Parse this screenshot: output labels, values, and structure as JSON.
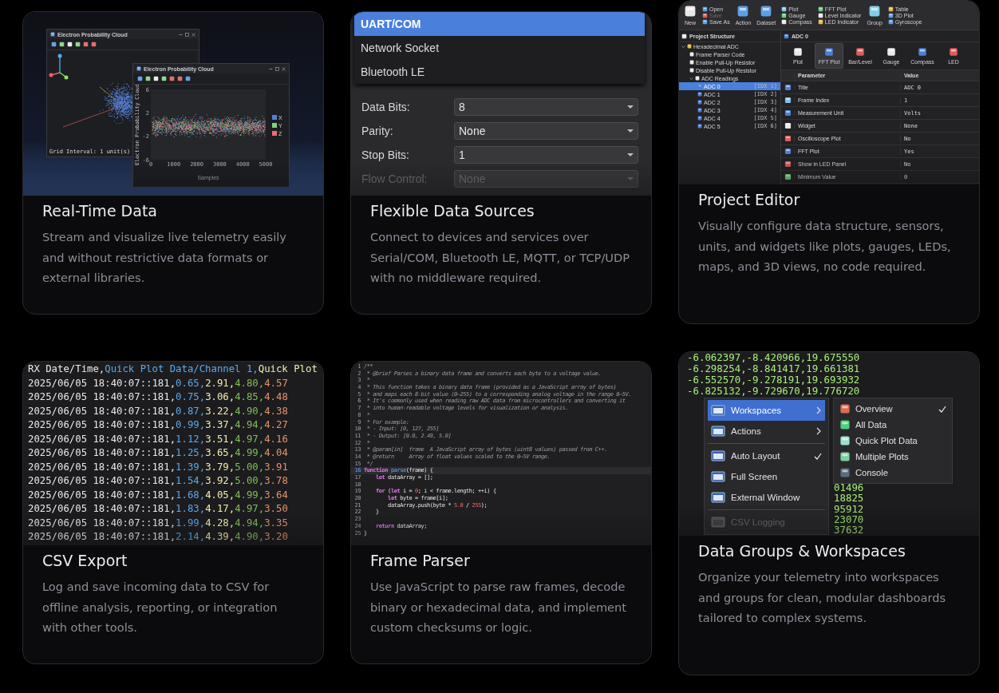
{
  "cards": [
    {
      "kind": "plots",
      "title": "Real-Time Data",
      "description": "Stream and visualize live telemetry easily and without restrictive data formats or external libraries.",
      "windows": [
        {
          "kind": "scene",
          "title": "Electron Probability Cloud",
          "caption": "Grid Interval: 1 unit(s)"
        },
        {
          "kind": "plot",
          "title": "Electron Probability Cloud",
          "xlabel": "Samples",
          "ylabel": "Electron Probability Cloud",
          "yticks": [
            "6",
            "2",
            "-2",
            "-6"
          ],
          "xticks": [
            "0",
            "1000",
            "2000",
            "3000",
            "4000",
            "5000"
          ],
          "legend": [
            {
              "label": "X",
              "color": "#4f7fe0"
            },
            {
              "label": "Y",
              "color": "#7fd67a"
            },
            {
              "label": "Z",
              "color": "#f06a78"
            }
          ]
        }
      ]
    },
    {
      "kind": "sources",
      "title": "Flexible Data Sources",
      "description": "Connect to devices and services over Serial/COM, Bluetooth LE, MQTT, or TCP/UDP with no middleware required.",
      "options": [
        {
          "label": "UART/COM",
          "selected": true
        },
        {
          "label": "Network Socket",
          "selected": false
        },
        {
          "label": "Bluetooth LE",
          "selected": false
        }
      ],
      "fields": [
        {
          "label": "Data Bits:",
          "value": "8",
          "disabled": false
        },
        {
          "label": "Parity:",
          "value": "None",
          "disabled": false
        },
        {
          "label": "Stop Bits:",
          "value": "1",
          "disabled": false
        },
        {
          "label": "Flow Control:",
          "value": "None",
          "disabled": true
        }
      ]
    },
    {
      "kind": "editor",
      "title": "Project Editor",
      "description": "Visually configure data structure, sensors, units, and widgets like plots, gauges, LEDs, maps, and 3D views, no code required.",
      "toolbar": [
        {
          "kind": "large",
          "label": "New"
        },
        {
          "kind": "stack",
          "items": [
            {
              "label": "Open",
              "disabled": false
            },
            {
              "label": "Save",
              "disabled": true
            },
            {
              "label": "Save As",
              "disabled": false
            }
          ]
        },
        {
          "kind": "large",
          "label": "Action"
        },
        {
          "kind": "large",
          "label": "Dataset"
        },
        {
          "kind": "stack",
          "items": [
            {
              "label": "Plot",
              "disabled": false
            },
            {
              "label": "Gauge",
              "disabled": false
            },
            {
              "label": "Compass",
              "disabled": false
            }
          ]
        },
        {
          "kind": "stack",
          "items": [
            {
              "label": "FFT Plot",
              "disabled": false
            },
            {
              "label": "Level Indicator",
              "disabled": false
            },
            {
              "label": "LED Indicator",
              "disabled": false
            }
          ]
        },
        {
          "kind": "large",
          "label": "Group"
        },
        {
          "kind": "stack",
          "items": [
            {
              "label": "Table",
              "disabled": false
            },
            {
              "label": "3D Plot",
              "disabled": false
            },
            {
              "label": "Gyroscope",
              "disabled": false
            }
          ]
        }
      ],
      "sidebar": {
        "title": "Project Structure",
        "tree": [
          {
            "label": "Hexadecimal ADC",
            "selected": false,
            "expanded": true,
            "children": [
              {
                "label": "Frame Parser Code",
                "selected": false
              },
              {
                "label": "Enable Pull-Up Resistor",
                "selected": false
              },
              {
                "label": "Disable Pull-Up Resistor",
                "selected": false
              },
              {
                "label": "ADC Readings",
                "selected": false,
                "expanded": true,
                "children": [
                  {
                    "label": "ADC 0",
                    "index": "[IDX 1]",
                    "selected": true
                  },
                  {
                    "label": "ADC 1",
                    "index": "[IDX 2]",
                    "selected": false
                  },
                  {
                    "label": "ADC 2",
                    "index": "[IDX 3]",
                    "selected": false
                  },
                  {
                    "label": "ADC 3",
                    "index": "[IDX 4]",
                    "selected": false
                  },
                  {
                    "label": "ADC 4",
                    "index": "[IDX 5]",
                    "selected": false
                  },
                  {
                    "label": "ADC 5",
                    "index": "[IDX 6]",
                    "selected": false
                  }
                ]
              }
            ]
          }
        ]
      },
      "panel": {
        "title": "ADC 0",
        "widgets": [
          {
            "label": "Plot",
            "selected": false
          },
          {
            "label": "FFT Plot",
            "selected": true
          },
          {
            "label": "Bar/Level",
            "selected": false
          },
          {
            "label": "Gauge",
            "selected": false
          },
          {
            "label": "Compass",
            "selected": false
          },
          {
            "label": "LED",
            "selected": false
          }
        ],
        "columns": [
          "Parameter",
          "Value"
        ],
        "rows": [
          {
            "parameter": "Title",
            "value": "ADC 0"
          },
          {
            "parameter": "Frame Index",
            "value": "1"
          },
          {
            "parameter": "Measurement Unit",
            "value": "Volts"
          },
          {
            "parameter": "Widget",
            "value": "None"
          },
          {
            "parameter": "Oscilloscope Plot",
            "value": "No"
          },
          {
            "parameter": "FFT Plot",
            "value": "Yes"
          },
          {
            "parameter": "Show in LED Panel",
            "value": "No"
          },
          {
            "parameter": "Minimum Value",
            "value": "0"
          }
        ]
      }
    },
    {
      "kind": "csv",
      "title": "CSV Export",
      "description": "Log and save incoming data to CSV for offline analysis, reporting, or integration with other tools.",
      "header": [
        "RX Date/Time,",
        "Quick Plot Data/Channel 1,",
        "Quick Plot"
      ],
      "rows": [
        {
          "time": "2025/06/05 18:40:07::181,",
          "values": [
            "0.65,",
            "2.91,",
            "4.80,",
            "4.57"
          ]
        },
        {
          "time": "2025/06/05 18:40:07::181,",
          "values": [
            "0.75,",
            "3.06,",
            "4.85,",
            "4.48"
          ]
        },
        {
          "time": "2025/06/05 18:40:07::181,",
          "values": [
            "0.87,",
            "3.22,",
            "4.90,",
            "4.38"
          ]
        },
        {
          "time": "2025/06/05 18:40:07::181,",
          "values": [
            "0.99,",
            "3.37,",
            "4.94,",
            "4.27"
          ]
        },
        {
          "time": "2025/06/05 18:40:07::181,",
          "values": [
            "1.12,",
            "3.51,",
            "4.97,",
            "4.16"
          ]
        },
        {
          "time": "2025/06/05 18:40:07::181,",
          "values": [
            "1.25,",
            "3.65,",
            "4.99,",
            "4.04"
          ]
        },
        {
          "time": "2025/06/05 18:40:07::181,",
          "values": [
            "1.39,",
            "3.79,",
            "5.00,",
            "3.91"
          ]
        },
        {
          "time": "2025/06/05 18:40:07::181,",
          "values": [
            "1.54,",
            "3.92,",
            "5.00,",
            "3.78"
          ]
        },
        {
          "time": "2025/06/05 18:40:07::181,",
          "values": [
            "1.68,",
            "4.05,",
            "4.99,",
            "3.64"
          ]
        },
        {
          "time": "2025/06/05 18:40:07::181,",
          "values": [
            "1.83,",
            "4.17,",
            "4.97,",
            "3.50"
          ]
        },
        {
          "time": "2025/06/05 18:40:07::181,",
          "values": [
            "1.99,",
            "4.28,",
            "4.94,",
            "3.35"
          ]
        },
        {
          "time": "2025/06/05 18:40:07::181,",
          "values": [
            "2.14,",
            "4.39,",
            "4.90,",
            "3.20"
          ]
        }
      ]
    },
    {
      "kind": "code",
      "title": "Frame Parser",
      "description": "Use JavaScript to parse raw frames, decode binary or hexadecimal data, and implement custom checksums or logic.",
      "lines": [
        {
          "number": "1",
          "current": false,
          "tokens": [
            {
              "kind": "comment",
              "text": "/**"
            }
          ]
        },
        {
          "number": "2",
          "current": false,
          "tokens": [
            {
              "kind": "comment",
              "text": " * @brief Parses a binary data frame and converts each byte to a voltage value."
            }
          ]
        },
        {
          "number": "3",
          "current": false,
          "tokens": [
            {
              "kind": "comment",
              "text": " *"
            }
          ]
        },
        {
          "number": "4",
          "current": false,
          "tokens": [
            {
              "kind": "comment",
              "text": " * This function takes a binary data frame (provided as a JavaScript array of bytes)"
            }
          ]
        },
        {
          "number": "5",
          "current": false,
          "tokens": [
            {
              "kind": "comment",
              "text": " * and maps each 8-bit value (0–255) to a corresponding analog voltage in the range 0–5V."
            }
          ]
        },
        {
          "number": "6",
          "current": false,
          "tokens": [
            {
              "kind": "comment",
              "text": " * It's commonly used when reading raw ADC data from microcontrollers and converting it"
            }
          ]
        },
        {
          "number": "7",
          "current": false,
          "tokens": [
            {
              "kind": "comment",
              "text": " * into human-readable voltage levels for visualization or analysis."
            }
          ]
        },
        {
          "number": "8",
          "current": false,
          "tokens": [
            {
              "kind": "comment",
              "text": " *"
            }
          ]
        },
        {
          "number": "9",
          "current": false,
          "tokens": [
            {
              "kind": "comment",
              "text": " * For example:"
            }
          ]
        },
        {
          "number": "10",
          "current": false,
          "tokens": [
            {
              "kind": "comment",
              "text": " * - Input: [0, 127, 255]"
            }
          ]
        },
        {
          "number": "11",
          "current": false,
          "tokens": [
            {
              "kind": "comment",
              "text": " * - Output: [0.0, 2.49, 5.0]"
            }
          ]
        },
        {
          "number": "12",
          "current": false,
          "tokens": [
            {
              "kind": "comment",
              "text": " *"
            }
          ]
        },
        {
          "number": "13",
          "current": false,
          "tokens": [
            {
              "kind": "comment",
              "text": " * @param[in]  frame  A JavaScript array of bytes (uint8 values) passed from C++."
            }
          ]
        },
        {
          "number": "14",
          "current": false,
          "tokens": [
            {
              "kind": "comment",
              "text": " * @return     Array of float values scaled to the 0–5V range."
            }
          ]
        },
        {
          "number": "15",
          "current": false,
          "tokens": [
            {
              "kind": "comment",
              "text": " */"
            }
          ]
        },
        {
          "number": "16",
          "current": true,
          "tokens": [
            {
              "kind": "keyword",
              "text": "function"
            },
            {
              "kind": "func",
              "text": " parse"
            },
            {
              "kind": "plain",
              "text": "(frame) {"
            }
          ]
        },
        {
          "number": "17",
          "current": false,
          "tokens": [
            {
              "kind": "keyword",
              "text": "    let"
            },
            {
              "kind": "plain",
              "text": " dataArray = [];"
            }
          ]
        },
        {
          "number": "18",
          "current": false
        },
        {
          "number": "19",
          "current": false,
          "tokens": [
            {
              "kind": "keyword",
              "text": "    for"
            },
            {
              "kind": "plain",
              "text": " ("
            },
            {
              "kind": "keyword",
              "text": "let"
            },
            {
              "kind": "plain",
              "text": " i = "
            },
            {
              "kind": "number",
              "text": "0"
            },
            {
              "kind": "plain",
              "text": "; i < frame.length; ++i) {"
            }
          ]
        },
        {
          "number": "20",
          "current": false,
          "tokens": [
            {
              "kind": "keyword",
              "text": "        let"
            },
            {
              "kind": "plain",
              "text": " byte = frame[i];"
            }
          ]
        },
        {
          "number": "21",
          "current": false,
          "tokens": [
            {
              "kind": "plain",
              "text": "        dataArray.push(byte * "
            },
            {
              "kind": "number",
              "text": "5.0"
            },
            {
              "kind": "plain",
              "text": " / "
            },
            {
              "kind": "number",
              "text": "255"
            },
            {
              "kind": "plain",
              "text": ");"
            }
          ]
        },
        {
          "number": "22",
          "current": false,
          "tokens": [
            {
              "kind": "plain",
              "text": "    }"
            }
          ]
        },
        {
          "number": "23",
          "current": false
        },
        {
          "number": "24",
          "current": false,
          "tokens": [
            {
              "kind": "keyword",
              "text": "    return"
            },
            {
              "kind": "plain",
              "text": " dataArray;"
            }
          ]
        },
        {
          "number": "25",
          "current": false,
          "tokens": [
            {
              "kind": "plain",
              "text": "}"
            }
          ]
        }
      ]
    },
    {
      "kind": "menu",
      "title": "Data Groups & Workspaces",
      "description": "Organize your telemetry into workspaces and groups for clean, modular dashboards tailored to complex systems.",
      "console_lines": [
        "-6.062397,-8.420966,19.675550",
        "-6.298254,-8.841417,19.661381",
        "-6.552570,-9.278191,19.693932",
        "-6.825132,-9.729670,19.776720"
      ],
      "console_tail": [
        "01496",
        "18825",
        "95912",
        "23070",
        "37632"
      ],
      "menu": [
        {
          "kind": "submenu",
          "label": "Workspaces",
          "selected": true,
          "checked": false,
          "disabled": false
        },
        {
          "kind": "submenu",
          "label": "Actions",
          "selected": false,
          "checked": false,
          "disabled": false
        },
        {
          "kind": "separator"
        },
        {
          "kind": "check",
          "label": "Auto Layout",
          "selected": false,
          "checked": true,
          "disabled": false
        },
        {
          "kind": "action",
          "label": "Full Screen",
          "selected": false,
          "checked": false,
          "disabled": false
        },
        {
          "kind": "action",
          "label": "External Window",
          "selected": false,
          "checked": false,
          "disabled": false
        },
        {
          "kind": "separator"
        },
        {
          "kind": "action",
          "label": "CSV Logging",
          "selected": false,
          "checked": false,
          "disabled": true
        }
      ],
      "submenu": [
        {
          "label": "Overview",
          "checked": true
        },
        {
          "label": "All Data",
          "checked": false
        },
        {
          "label": "Quick Plot Data",
          "checked": false
        },
        {
          "label": "Multiple Plots",
          "checked": false
        },
        {
          "label": "Console",
          "checked": false
        }
      ]
    }
  ]
}
